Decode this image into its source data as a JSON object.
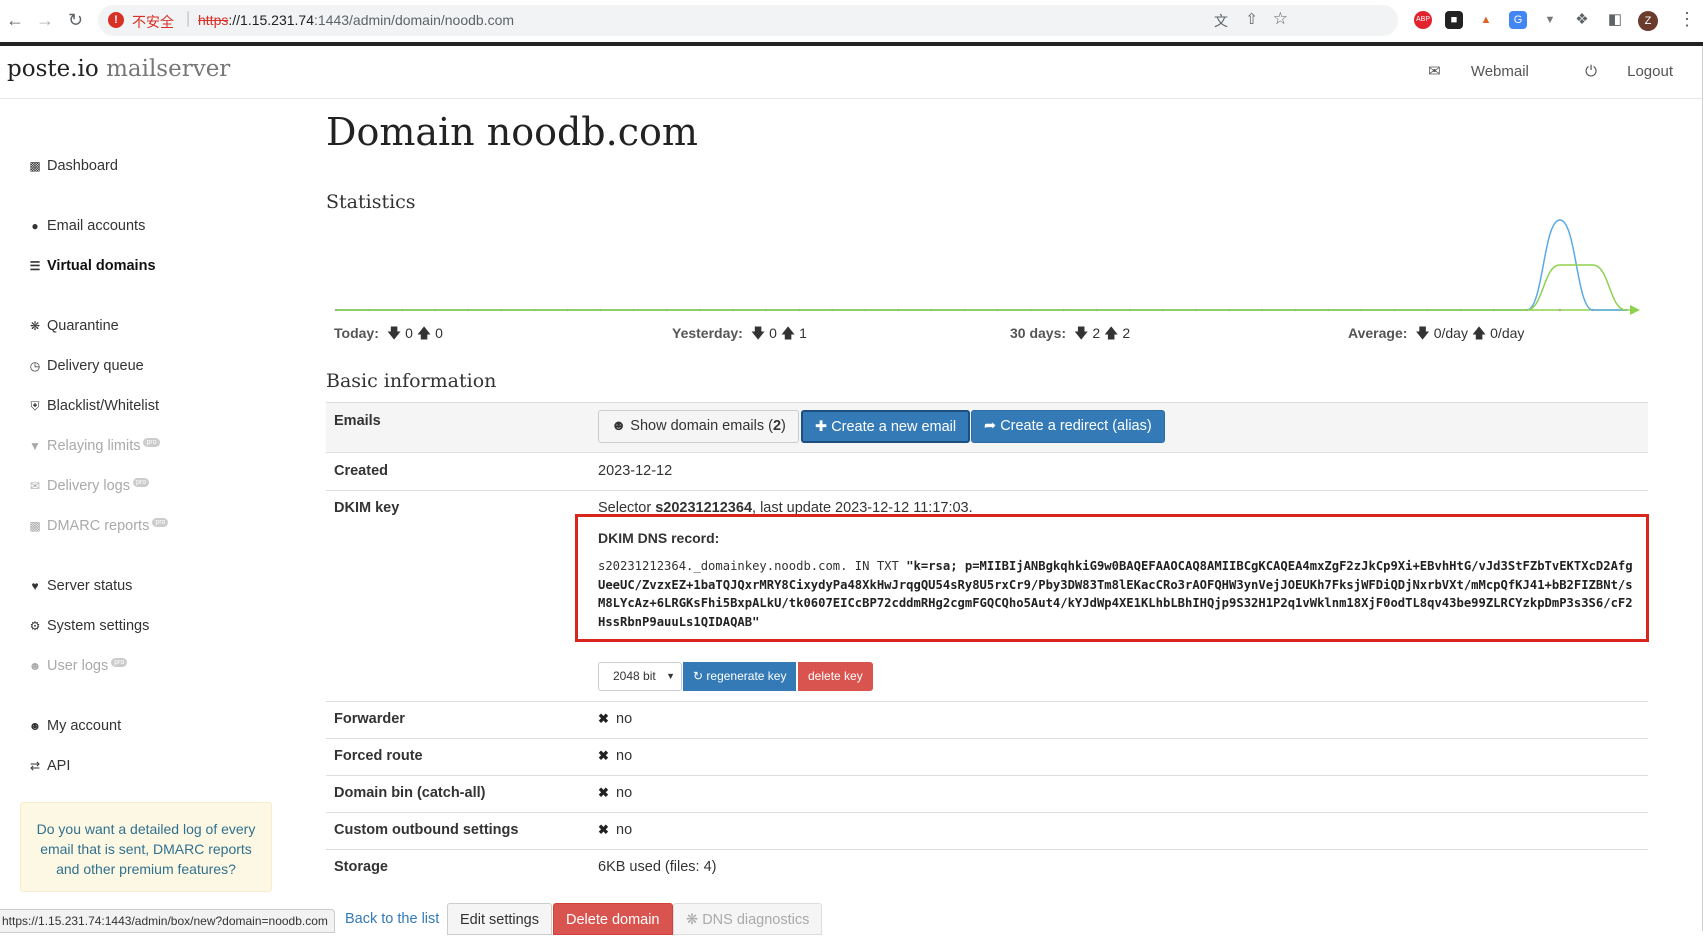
{
  "browser": {
    "insecure_label": "不安全",
    "url_protocol": "https",
    "url_host": "://1.15.231.74",
    "url_rest": ":1443/admin/domain/noodb.com",
    "status_url": "https://1.15.231.74:1443/admin/box/new?domain=noodb.com",
    "profile_initial": "Z",
    "abp_label": "ABP"
  },
  "header": {
    "brand": "poste.io",
    "brand_sub": "mailserver",
    "webmail": "Webmail",
    "logout": "Logout"
  },
  "sidebar": {
    "items": [
      {
        "label": "Dashboard",
        "icon": "bar-chart-icon"
      },
      {
        "label": "Email accounts",
        "icon": "users-icon"
      },
      {
        "label": "Virtual domains",
        "icon": "database-icon"
      },
      {
        "label": "Quarantine",
        "icon": "bug-icon"
      },
      {
        "label": "Delivery queue",
        "icon": "clock-icon"
      },
      {
        "label": "Blacklist/Whitelist",
        "icon": "shield-icon"
      },
      {
        "label": "Relaying limits",
        "icon": "filter-icon"
      },
      {
        "label": "Delivery logs",
        "icon": "envelope-icon"
      },
      {
        "label": "DMARC reports",
        "icon": "bar-chart-icon"
      },
      {
        "label": "Server status",
        "icon": "heartbeat-icon"
      },
      {
        "label": "System settings",
        "icon": "cogs-icon"
      },
      {
        "label": "User logs",
        "icon": "user-icon"
      },
      {
        "label": "My account",
        "icon": "user-icon"
      },
      {
        "label": "API",
        "icon": "exchange-icon"
      }
    ],
    "pro_badge": "pro",
    "promo": "Do you want a detailed log of every email that is sent, DMARC reports and other premium features?"
  },
  "main": {
    "title": "Domain noodb.com",
    "statistics_heading": "Statistics",
    "stats": {
      "today_label": "Today:",
      "today_in": "0",
      "today_out": "0",
      "yesterday_label": "Yesterday:",
      "yesterday_in": "0",
      "yesterday_out": "1",
      "days30_label": "30 days:",
      "days30_in": "2",
      "days30_out": "2",
      "average_label": "Average:",
      "average_in": "0/day",
      "average_out": "0/day"
    },
    "basic_heading": "Basic information",
    "emails_label": "Emails",
    "show_emails_btn": "Show domain emails",
    "show_emails_count": "2",
    "create_email_btn": "Create a new email",
    "create_redirect_btn": "Create a redirect (alias)",
    "created_label": "Created",
    "created_value": "2023-12-12",
    "dkim_label": "DKIM key",
    "dkim_selector_prefix": "Selector",
    "dkim_selector": "s20231212364",
    "dkim_update": ", last update 2023-12-12 11:17:03.",
    "dkim_dns_title": "DKIM DNS record:",
    "dkim_record_prefix": "s20231212364._domainkey.noodb.com. IN TXT ",
    "dkim_record_value": "\"k=rsa; p=MIIBIjANBgkqhkiG9w0BAQEFAAOCAQ8AMIIBCgKCAQEA4mxZgF2zJkCp9Xi+EBvhHtG/vJd3StFZbTvEKTXcD2AfgUeeUC/ZvzxEZ+1baTQJQxrMRY8CixydyPa48XkHwJrqgQU54sRy8U5rxCr9/Pby3DW83Tm8lEKacCRo3rAOFQHW3ynVejJOEUKh7FksjWFDiQDjNxrbVXt/mMcpQfKJ41+bB2FIZBNt/sM8LYcAz+6LRGKsFhi5BxpALkU/tk0607EICcBP72cddmRHg2cgmFGQCQho5Aut4/kYJdWp4XE1KLhbLBhIHQjp9S32H1P2q1vWklnm18XjF0odTL8qv43be99ZLRCYzkpDmP3s3S6/cF2HssRbnP9auuLs1QIDAQAB\"",
    "key_size": "2048 bit",
    "regenerate_btn": "regenerate key",
    "delete_key_btn": "delete key",
    "forwarder_label": "Forwarder",
    "forced_route_label": "Forced route",
    "domain_bin_label": "Domain bin (catch-all)",
    "custom_outbound_label": "Custom outbound settings",
    "no_value": "no",
    "storage_label": "Storage",
    "storage_value": "6KB used (files: 4)",
    "back_link": "Back to the list",
    "edit_btn": "Edit settings",
    "delete_domain_btn": "Delete domain",
    "dns_diag_btn": "DNS diagnostics"
  },
  "chart_data": {
    "type": "line",
    "x_points": 40,
    "series": [
      {
        "color": "#5aa9e6",
        "values": [
          0,
          0,
          0,
          0,
          0,
          0,
          0,
          0,
          0,
          0,
          0,
          0,
          0,
          0,
          0,
          0,
          0,
          0,
          0,
          0,
          0,
          0,
          0,
          0,
          0,
          0,
          0,
          0,
          0,
          0,
          0,
          0,
          0,
          0,
          0,
          0,
          0,
          2,
          0,
          0
        ]
      },
      {
        "color": "#8ed14f",
        "values": [
          0,
          0,
          0,
          0,
          0,
          0,
          0,
          0,
          0,
          0,
          0,
          0,
          0,
          0,
          0,
          0,
          0,
          0,
          0,
          0,
          0,
          0,
          0,
          0,
          0,
          0,
          0,
          0,
          0,
          0,
          0,
          0,
          0,
          0,
          0,
          0,
          0,
          1,
          1,
          0
        ]
      }
    ],
    "colors": {
      "in": "#5aa9e6",
      "out": "#8ed14f"
    }
  },
  "colors": {
    "primary": "#337ab7",
    "danger": "#d9534f",
    "highlight_box": "#d9261c"
  }
}
